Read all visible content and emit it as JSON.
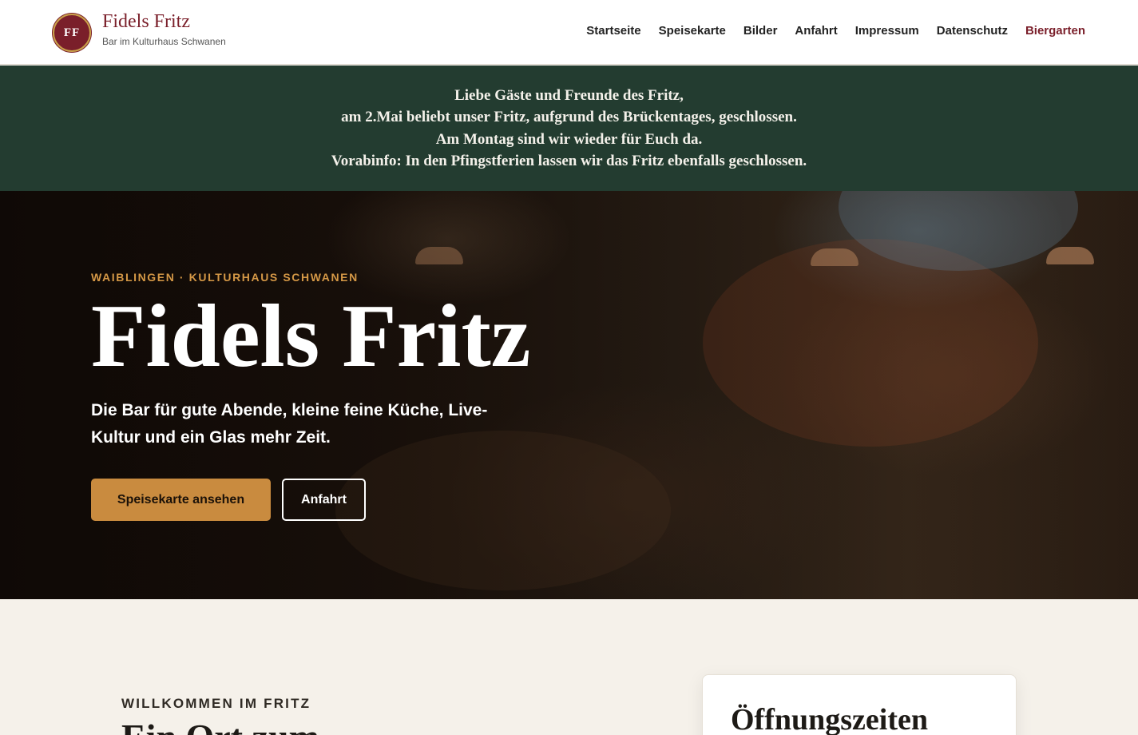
{
  "header": {
    "logo_text": "FF",
    "brand_name": "Fidels Fritz",
    "brand_subtitle": "Bar im Kulturhaus Schwanen",
    "nav": [
      {
        "label": "Startseite"
      },
      {
        "label": "Speisekarte"
      },
      {
        "label": "Bilder"
      },
      {
        "label": "Anfahrt"
      },
      {
        "label": "Impressum"
      },
      {
        "label": "Datenschutz"
      },
      {
        "label": "Biergarten"
      }
    ]
  },
  "notice": {
    "lines": [
      "Liebe Gäste und Freunde des Fritz,",
      "am 2.Mai beliebt unser Fritz, aufgrund des Brückentages, geschlossen.",
      "Am Montag sind wir wieder für Euch da.",
      "Vorabinfo: In den Pfingstferien lassen wir das Fritz ebenfalls geschlossen."
    ],
    "background_color": "#233c30"
  },
  "hero": {
    "eyebrow": "WAIBLINGEN · KULTURHAUS SCHWANEN",
    "title": "Fidels Fritz",
    "text": "Die Bar für gute Abende, kleine feine Küche, Live-Kultur und ein Glas mehr Zeit.",
    "primary_button": "Speisekarte ansehen",
    "secondary_button": "Anfahrt",
    "accent_color": "#c98b3f"
  },
  "welcome": {
    "eyebrow": "WILLKOMMEN IM FRITZ",
    "title": "Ein Ort zum"
  },
  "hours": {
    "title": "Öffnungszeiten"
  },
  "colors": {
    "brand": "#7a1f2a",
    "page_background": "#f5f1ea"
  }
}
